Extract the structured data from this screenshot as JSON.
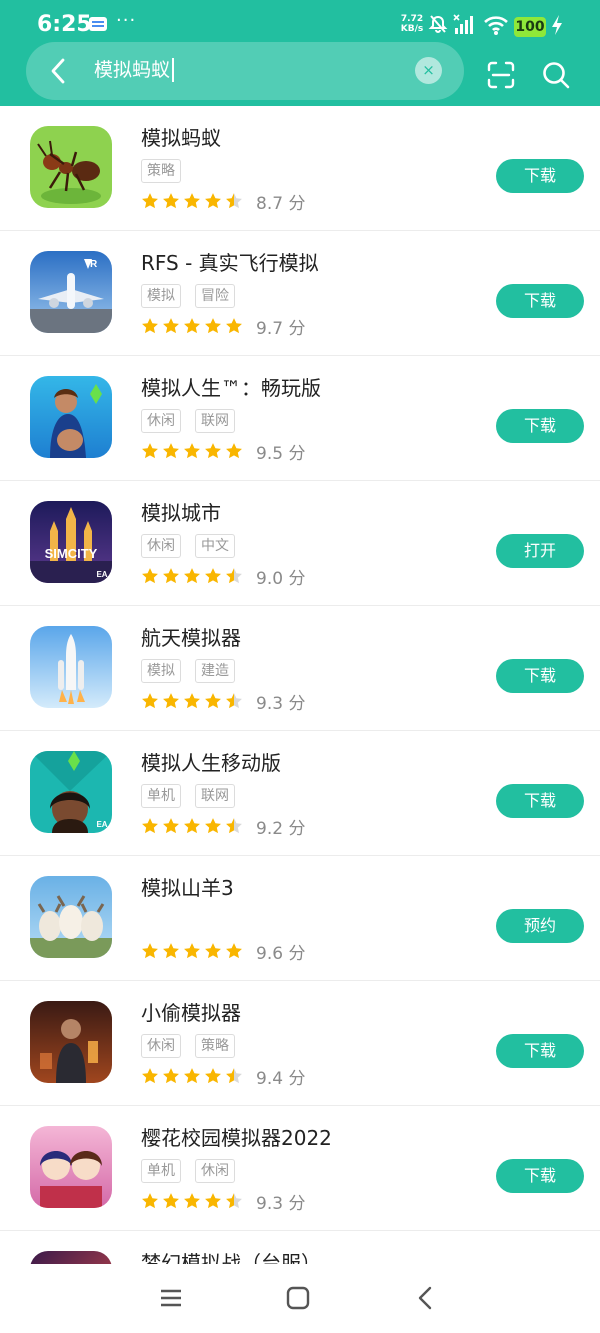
{
  "status_bar": {
    "time": "6:25",
    "dots": "···",
    "net_speed_value": "7.72",
    "net_speed_unit": "KB/s",
    "battery": "100"
  },
  "search": {
    "value": "模拟蚂蚁",
    "clear_symbol": "×"
  },
  "colors": {
    "accent": "#22bfa0",
    "star": "#f9b600",
    "star_empty": "#d9d9d9",
    "battery": "#8fe83a"
  },
  "apps": [
    {
      "name": "模拟蚂蚁",
      "tags": [
        "策略"
      ],
      "rating": 4.5,
      "score": "8.7 分",
      "action": "下载",
      "icon": "ant-icon"
    },
    {
      "name": "RFS - 真实飞行模拟",
      "tags": [
        "模拟",
        "冒险"
      ],
      "rating": 5,
      "score": "9.7 分",
      "action": "下载",
      "icon": "airplane-icon"
    },
    {
      "name": "模拟人生™：畅玩版",
      "tags": [
        "休闲",
        "联网"
      ],
      "rating": 5,
      "score": "9.5 分",
      "action": "下载",
      "icon": "sims-woman-icon"
    },
    {
      "name": "模拟城市",
      "tags": [
        "休闲",
        "中文"
      ],
      "rating": 4.5,
      "score": "9.0 分",
      "action": "打开",
      "icon": "simcity-icon",
      "icon_text": "SIMCITY",
      "icon_badge": "EA"
    },
    {
      "name": "航天模拟器",
      "tags": [
        "模拟",
        "建造"
      ],
      "rating": 4.5,
      "score": "9.3 分",
      "action": "下载",
      "icon": "rocket-icon"
    },
    {
      "name": "模拟人生移动版",
      "tags": [
        "单机",
        "联网"
      ],
      "rating": 4.5,
      "score": "9.2 分",
      "action": "下载",
      "icon": "sims-mobile-icon",
      "icon_badge": "EA"
    },
    {
      "name": "模拟山羊3",
      "tags": [],
      "rating": 5,
      "score": "9.6 分",
      "action": "预约",
      "icon": "goats-icon"
    },
    {
      "name": "小偷模拟器",
      "tags": [
        "休闲",
        "策略"
      ],
      "rating": 4.5,
      "score": "9.4 分",
      "action": "下载",
      "icon": "thief-icon"
    },
    {
      "name": "樱花校园模拟器2022",
      "tags": [
        "单机",
        "休闲"
      ],
      "rating": 4.5,
      "score": "9.3 分",
      "action": "下载",
      "icon": "anime-school-icon"
    },
    {
      "name": "梦幻模拟战（台服）",
      "tags": [],
      "rating": 0,
      "score": "",
      "action": "",
      "icon": "langrisser-icon"
    }
  ]
}
